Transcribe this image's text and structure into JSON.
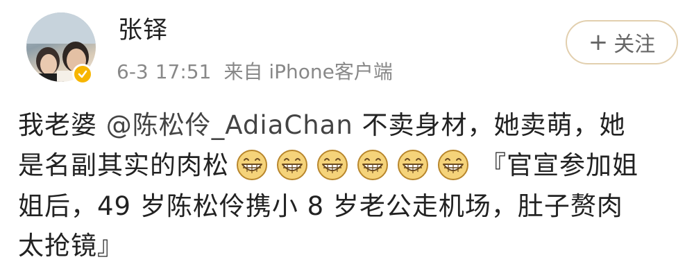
{
  "post": {
    "author": {
      "name": "张铎",
      "avatar_icon": "avatar-photo",
      "verified_icon": "verified-badge-icon",
      "verified_color": "#f7b500"
    },
    "meta": {
      "date": "6-3",
      "time": "17:51",
      "source": "来自 iPhone客户端"
    },
    "follow_button": {
      "plus": "+",
      "label": "关注",
      "border_color": "#e2cfae"
    },
    "text": {
      "line1_prefix": "我老婆 ",
      "mention": "@陈松伶_AdiaChan",
      "line1_suffix": " 不卖身材，她卖萌，她",
      "line2_prefix": "是名副其实的肉松",
      "emoji_icon": "grinning-face-icon",
      "emoji_count": 6,
      "line2_suffix": "『官宣参加姐",
      "line3": "姐后，49 岁陈松伶携小 8 岁老公走机场，肚子赘肉",
      "line4": "太抢镜』"
    }
  }
}
